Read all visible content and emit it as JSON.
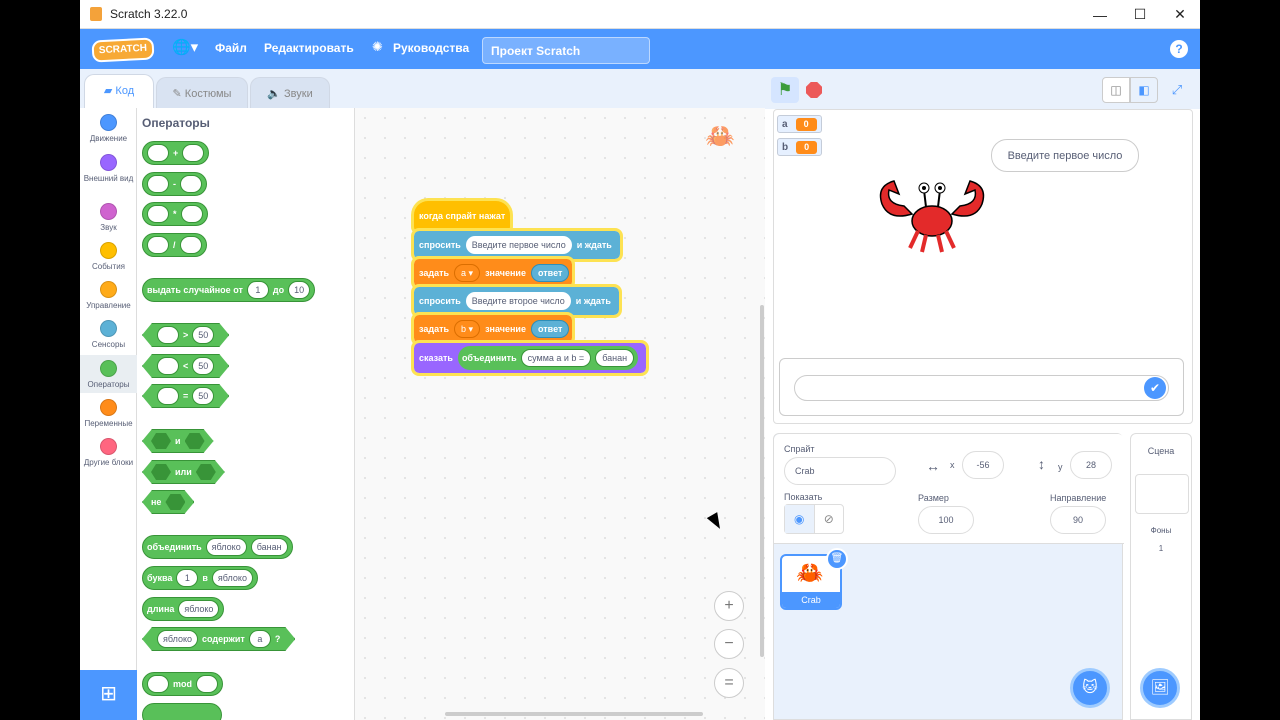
{
  "window": {
    "title": "Scratch 3.22.0"
  },
  "menubar": {
    "logo": "SCRATCH",
    "file": "Файл",
    "edit": "Редактировать",
    "tutorials": "Руководства",
    "project_title": "Проект Scratch",
    "help": "?"
  },
  "tabs": [
    "Код",
    "Костюмы",
    "Звуки"
  ],
  "categories": [
    "Движение",
    "Внешний вид",
    "Звук",
    "События",
    "Управление",
    "Сенсоры",
    "Операторы",
    "Переменные",
    "Другие блоки"
  ],
  "category_colors": [
    "#4c97ff",
    "#9966ff",
    "#cf63cf",
    "#ffbf00",
    "#ffab19",
    "#5cb1d6",
    "#59c059",
    "#ff8c1a",
    "#ff6680"
  ],
  "palette": {
    "heading": "Операторы",
    "plus": "+",
    "minus": "-",
    "times": "*",
    "divide": "/",
    "random": "выдать случайное от",
    "rand_from": "1",
    "rand_to_label": "до",
    "rand_to": "10",
    "gt": ">",
    "lt": "<",
    "eq": "=",
    "fifty": "50",
    "and": "и",
    "or": "или",
    "not": "не",
    "join": "объединить",
    "apple": "яблоко",
    "banana": "банан",
    "letter": "буква",
    "one": "1",
    "in": "в",
    "length": "длина",
    "contains": "содержит",
    "a": "а",
    "q": "?",
    "mod": "mod"
  },
  "script": {
    "hat": "когда спрайт нажат",
    "ask": "спросить",
    "ask1": "Введите первое число",
    "ask_wait": "и ждать",
    "set": "задать",
    "var_a": "a ▾",
    "value": "значение",
    "answer": "ответ",
    "ask2": "Введите второе число",
    "var_b": "b ▾",
    "say": "сказать",
    "join": "объединить",
    "join_text": "сумма a и b =",
    "banana": "банан"
  },
  "zoom": {
    "in": "+",
    "out": "−",
    "reset": "="
  },
  "stage": {
    "monitors": [
      {
        "name": "a",
        "value": "0"
      },
      {
        "name": "b",
        "value": "0"
      }
    ],
    "bubble": "Введите первое число",
    "answer_value": ""
  },
  "sprite": {
    "label": "Спрайт",
    "name": "Crab",
    "x_label": "x",
    "x": "-56",
    "y_label": "y",
    "y": "28",
    "show_label": "Показать",
    "size_label": "Размер",
    "size": "100",
    "dir_label": "Направление",
    "direction": "90",
    "thumb_name": "Crab"
  },
  "scene": {
    "label": "Сцена",
    "backdrops_label": "Фоны",
    "backdrops": "1"
  }
}
